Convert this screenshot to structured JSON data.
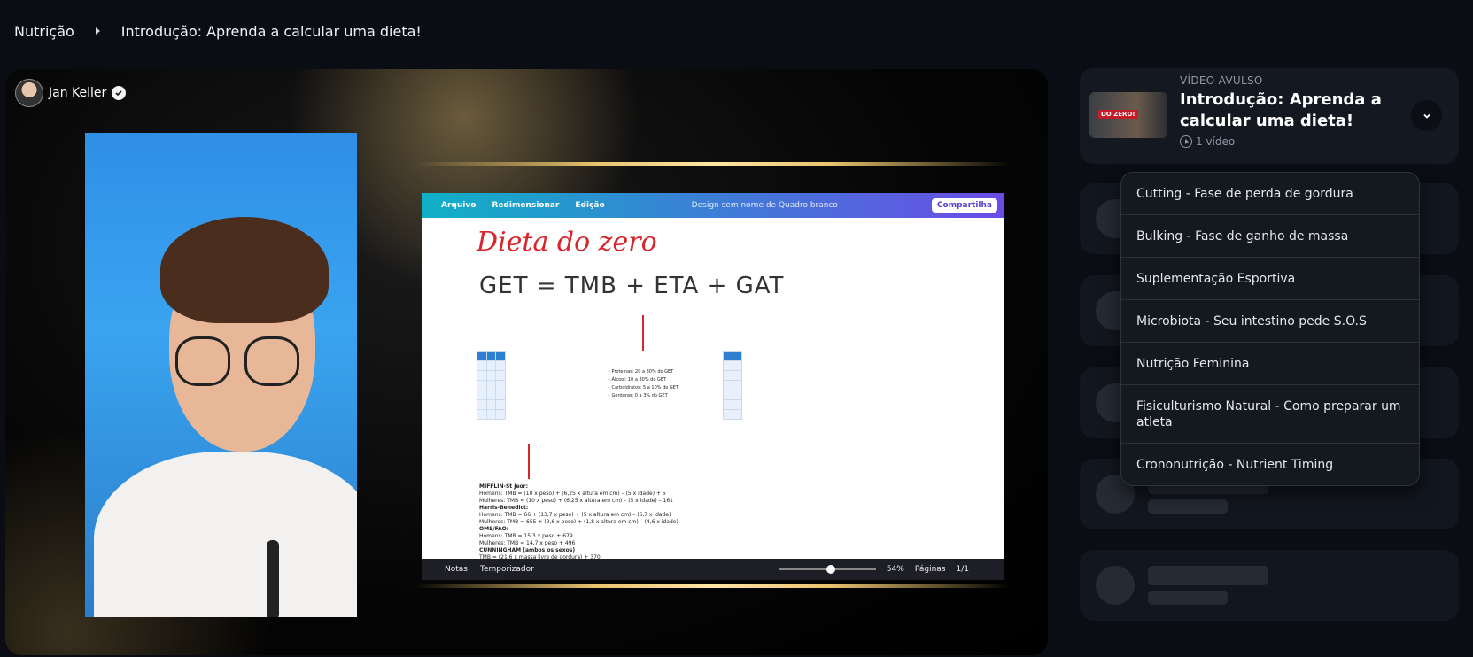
{
  "breadcrumb": {
    "course": "Nutrição",
    "lesson": "Introdução: Aprenda a calcular uma dieta!"
  },
  "player": {
    "author": "Jan Keller",
    "slide": {
      "menu": [
        "Arquivo",
        "Redimensionar",
        "Edição"
      ],
      "doc_name": "Design sem nome de Quadro branco",
      "share": "Compartilha",
      "handwritten_title": "Dieta do zero",
      "handwritten_equation": "GET = TMB + ETA + GAT",
      "notes": [
        "• Proteínas: 20 a 30% do GET",
        "• Álcool: 10 a 30% do GET",
        "• Carboidratos: 5 a 10% do GET",
        "• Gorduras: 0 a 3% do GET"
      ],
      "formulas": [
        "MIFFLIN-St Jeor:",
        "Homens: TMB = (10 x peso) + (6,25 x altura em cm) – (5 x idade) + 5",
        "Mulheres: TMB = (10 x peso) + (6,25 x altura em cm) – (5 x idade) – 161",
        "Harris-Benedict:",
        "Homens: TMB = 66 + (13,7 x peso) + (5 x altura em cm) – (6,7 x idade)",
        "Mulheres: TMB = 655 + (9,6 x peso) + (1,8 x altura em cm) – (4,6 x idade)",
        "OMS/FAO:",
        "Homens: TMB = 15,3 x peso + 679",
        "Mulheres: TMB = 14,7 x peso + 496",
        "CUNNINGHAM (ambos os sexos)",
        "TMB = (21,6 x massa livre de gordura) + 370"
      ],
      "footer_notes": "Notas",
      "footer_timer": "Temporizador",
      "zoom_label": "54%",
      "zoom_fraction": 0.54,
      "pages_label": "Páginas",
      "pages": "1/1"
    }
  },
  "sidebar": {
    "kicker": "VÍDEO AVULSO",
    "title": "Introdução: Aprenda a calcular uma dieta!",
    "count": "1 vídeo",
    "thumb_tag": "DO ZERO!"
  },
  "dropdown": {
    "items": [
      "Cutting - Fase de perda de gordura",
      "Bulking - Fase de ganho de massa",
      "Suplementação Esportiva",
      "Microbiota - Seu intestino pede S.O.S",
      "Nutrição Feminina",
      "Fisiculturismo Natural - Como preparar um atleta",
      "Crononutrição - Nutrient Timing"
    ]
  },
  "colors": {
    "background": "#0a0d14",
    "card": "#141821",
    "accent_gold": "#e8c36d",
    "canva_red": "#d7262b"
  }
}
